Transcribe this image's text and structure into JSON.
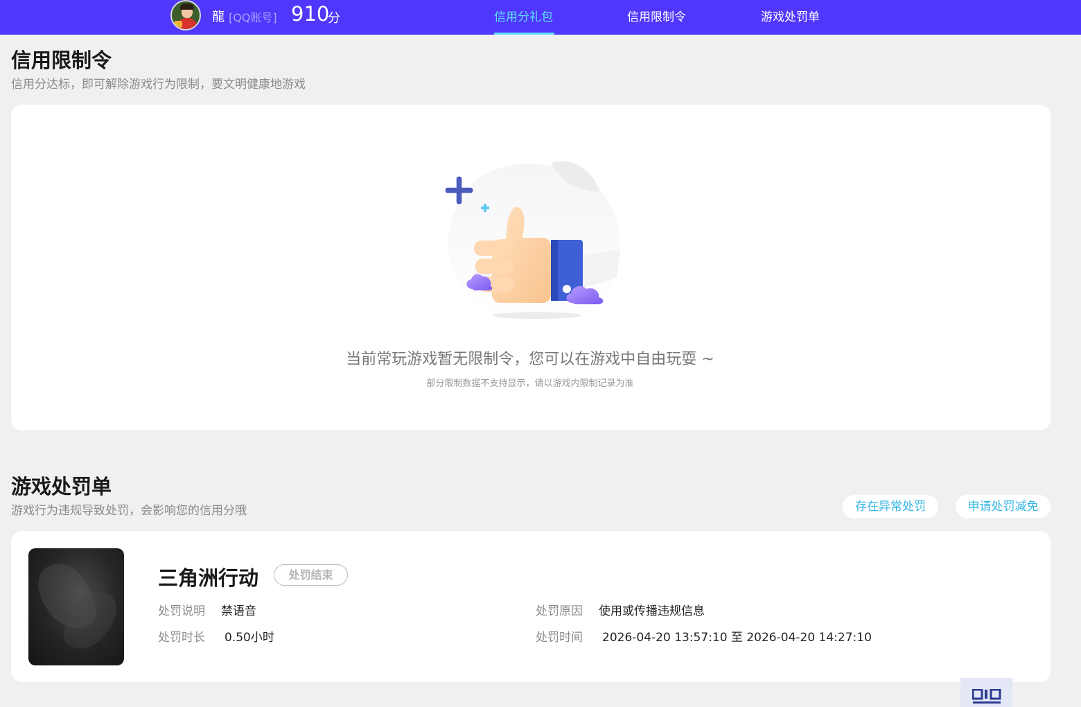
{
  "header": {
    "username": "龍",
    "account_type": "[QQ账号]",
    "score": "910",
    "score_unit": "分",
    "tabs": [
      {
        "label": "信用分礼包",
        "active": true
      },
      {
        "label": "信用限制令",
        "active": false
      },
      {
        "label": "游戏处罚单",
        "active": false
      }
    ],
    "accent_color": "#4f37fb",
    "active_tab_color": "#5fe0ff"
  },
  "restriction": {
    "title": "信用限制令",
    "subtitle": "信用分达标，即可解除游戏行为限制，要文明健康地游戏",
    "empty_illustration": "thumbs-up-illustration",
    "empty_message": "当前常玩游戏暂无限制令，您可以在游戏中自由玩耍 ~",
    "empty_note": "部分限制数据不支持显示，请以游戏内限制记录为准"
  },
  "penalty": {
    "title": "游戏处罚单",
    "subtitle": "游戏行为违规导致处罚，会影响您的信用分哦",
    "actions": [
      {
        "label": "存在异常处罚"
      },
      {
        "label": "申请处罚减免"
      }
    ],
    "records": [
      {
        "game_name": "三角洲行动",
        "status": "处罚结束",
        "desc_label": "处罚说明",
        "desc_value": "禁语音",
        "reason_label": "处罚原因",
        "reason_value": "使用或传播违规信息",
        "duration_label": "处罚时长",
        "duration_value": "0.50小时",
        "time_label": "处罚时间",
        "time_value": "2026-04-20 13:57:10 至 2026-04-20 14:27:10"
      }
    ]
  },
  "floating": {
    "icon": "qr-code-icon"
  }
}
